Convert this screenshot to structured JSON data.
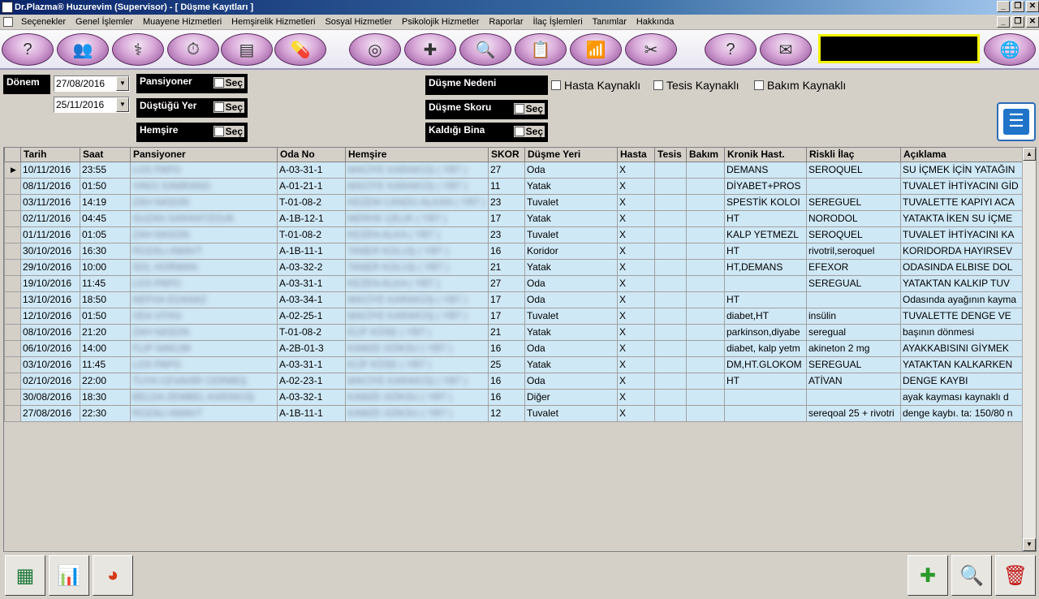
{
  "window": {
    "title": "Dr.Plazma® Huzurevim (Supervisor) - [ Düşme Kayıtları ]"
  },
  "menu": [
    "Seçenekler",
    "Genel İşlemler",
    "Muayene Hizmetleri",
    "Hemşirelik Hizmetleri",
    "Sosyal Hizmetler",
    "Psikolojik Hizmetler",
    "Raporlar",
    "İlaç İşlemleri",
    "Tanımlar",
    "Hakkında"
  ],
  "toolbar_icons": [
    "help-head-icon",
    "doctors-icon",
    "stethoscope-icon",
    "stopwatch-icon",
    "word-document-icon",
    "pills-icon",
    "spiral-icon",
    "bandage-icon",
    "report-magnifier-icon",
    "clipboard-icon",
    "bar-chart-icon",
    "tools-icon",
    "note-help-icon",
    "mail-icon",
    "globe-arrow-icon"
  ],
  "filters": {
    "donem_label": "Dönem",
    "date_from": "27/08/2016",
    "date_to": "25/11/2016",
    "pansiyoner_label": "Pansiyoner",
    "dustugu_yer_label": "Düştüğü Yer",
    "hemsire_label": "Hemşire",
    "dusme_nedeni_label": "Düşme Nedeni",
    "dusme_skoru_label": "Düşme Skoru",
    "kaldigi_bina_label": "Kaldığı Bina",
    "sec_label": "Seç",
    "hasta_kaynakli": "Hasta Kaynaklı",
    "tesis_kaynakli": "Tesis Kaynaklı",
    "bakim_kaynakli": "Bakım Kaynaklı"
  },
  "table": {
    "headers": [
      "Tarih",
      "Saat",
      "Pansiyoner",
      "Oda No",
      "Hemşire",
      "SKOR",
      "Düşme Yeri",
      "Hasta",
      "Tesis",
      "Bakım",
      "Kronik Hast.",
      "Riskli İlaç",
      "Açıklama"
    ],
    "rows": [
      [
        "10/11/2016",
        "23:55",
        "LGS PAPO",
        "A-03-31-1",
        "MACİYE KARAKÜŞ ( YBT )",
        "27",
        "Oda",
        "X",
        "",
        "",
        "DEMANS",
        "SEROQUEL",
        "SU İÇMEK İÇİN YATAĞIN"
      ],
      [
        "08/11/2016",
        "01:50",
        "YAKO SAMRANO",
        "A-01-21-1",
        "MACİYE KARAKÜŞ ( YBT )",
        "11",
        "Yatak",
        "X",
        "",
        "",
        "DİYABET+PROS",
        "",
        "TUVALET İHTİYACINI GİD"
      ],
      [
        "03/11/2016",
        "14:19",
        "ZAH NASON",
        "T-01-08-2",
        "KEZEM CANDU ALKAN ( YBT )",
        "23",
        "Tuvalet",
        "X",
        "",
        "",
        "SPESTİK KOLOI",
        "SEREGUEL",
        "TUVALETTE KAPIYI ACA"
      ],
      [
        "02/11/2016",
        "04:45",
        "SUZAN SARANTZOUK",
        "A-1B-12-1",
        "MERHE ÇELİK ( YBT )",
        "17",
        "Yatak",
        "X",
        "",
        "",
        "HT",
        "NORODOL",
        "YATAKTA İKEN SU İÇME"
      ],
      [
        "01/11/2016",
        "01:05",
        "ZAH NASON",
        "T-01-08-2",
        "KEZEN ALKA ( YBT )",
        "23",
        "Tuvalet",
        "X",
        "",
        "",
        "KALP YETMEZL",
        "SEROQUEL",
        "TUVALET İHTİYACINI KA"
      ],
      [
        "30/10/2016",
        "16:30",
        "ROZALI AMAVT",
        "A-1B-11-1",
        "TANER KOLUŞ ( YBT )",
        "16",
        "Koridor",
        "X",
        "",
        "",
        "HT",
        "rivotril,seroquel",
        "KORIDORDA HAYIRSEV"
      ],
      [
        "29/10/2016",
        "10:00",
        "SOL HORMAN",
        "A-03-32-2",
        "TANER KOLUŞ ( YBT )",
        "21",
        "Yatak",
        "X",
        "",
        "",
        "HT,DEMANS",
        "EFEXOR",
        "ODASINDA ELBISE DOL"
      ],
      [
        "19/10/2016",
        "11:45",
        "LGS PAPO",
        "A-03-31-1",
        "KEZEN ALKA ( YBT )",
        "27",
        "Oda",
        "X",
        "",
        "",
        "",
        "SEREGUAL",
        "YATAKTAN KALKIP TUV"
      ],
      [
        "13/10/2016",
        "18:50",
        "NEFHA EDANAZ",
        "A-03-34-1",
        "MACİYE KARAKÜŞ ( YBT )",
        "17",
        "Oda",
        "X",
        "",
        "",
        "HT",
        "",
        "Odasında ayağının kayma"
      ],
      [
        "12/10/2016",
        "01:50",
        "VEA VITAS",
        "A-02-25-1",
        "MACİYE KARAKÜŞ ( YBT )",
        "17",
        "Tuvalet",
        "X",
        "",
        "",
        "diabet,HT",
        "insülin",
        "TUVALETTE DENGE VE"
      ],
      [
        "08/10/2016",
        "21:20",
        "ZAH NASON",
        "T-01-08-2",
        "ELİF KÖSE ( YBT )",
        "21",
        "Yatak",
        "X",
        "",
        "",
        "parkinson,diyabe",
        "seregual",
        "başının dönmesi"
      ],
      [
        "06/10/2016",
        "14:00",
        "FLIP NAKUM",
        "A-2B-01-3",
        "KAMZE GÖKSU ( YBT )",
        "16",
        "Oda",
        "X",
        "",
        "",
        "diabet, kalp yetm",
        "akineton 2 mg",
        "AYAKKABISINI GİYMEK"
      ],
      [
        "03/10/2016",
        "11:45",
        "LGS PAPO",
        "A-03-31-1",
        "ELİF KÖSE ( YBT )",
        "25",
        "Yatak",
        "X",
        "",
        "",
        "DM,HT.GLOKOM",
        "SEREGUAL",
        "YATAKTAN KALKARKEN"
      ],
      [
        "02/10/2016",
        "22:00",
        "TUYA CEVAHİR CERMEŞ",
        "A-02-23-1",
        "MACİYE KARAKÜŞ ( YBT )",
        "16",
        "Oda",
        "X",
        "",
        "",
        "HT",
        "ATİVAN",
        "DENGE KAYBI"
      ],
      [
        "30/08/2016",
        "18:30",
        "BELDA ZEMBEL KARAKÜŞ",
        "A-03-32-1",
        "KAMZE GÖKSU ( YBT )",
        "16",
        "Diğer",
        "X",
        "",
        "",
        "",
        "",
        "ayak kayması kaynaklı d"
      ],
      [
        "27/08/2016",
        "22:30",
        "ROZALI AMAVT",
        "A-1B-11-1",
        "KAMZE GÖKSU ( YBT )",
        "12",
        "Tuvalet",
        "X",
        "",
        "",
        "",
        "sereqoal 25 + rivotri",
        "denge kaybı. ta: 150/80 n"
      ]
    ]
  }
}
